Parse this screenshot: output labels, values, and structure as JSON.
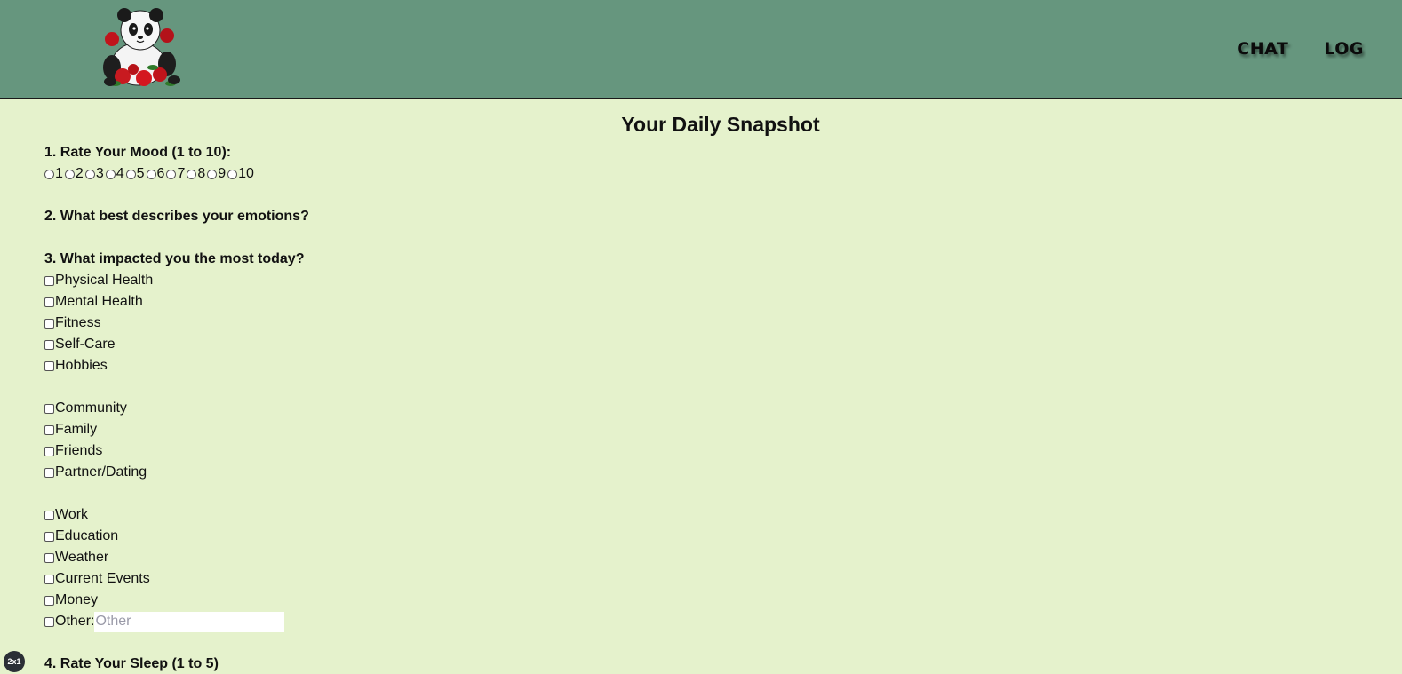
{
  "nav": {
    "chat": "CHAT",
    "log": "LOG"
  },
  "page_title": "Your Daily Snapshot",
  "q1": {
    "label": "1. Rate Your Mood (1 to 10):",
    "options": [
      "1",
      "2",
      "3",
      "4",
      "5",
      "6",
      "7",
      "8",
      "9",
      "10"
    ]
  },
  "q2": {
    "label": "2. What best describes your emotions?"
  },
  "q3": {
    "label": "3. What impacted you the most today?",
    "group1": [
      "Physical Health",
      "Mental Health",
      "Fitness",
      "Self-Care",
      "Hobbies"
    ],
    "group2": [
      "Community",
      "Family",
      "Friends",
      "Partner/Dating"
    ],
    "group3": [
      "Work",
      "Education",
      "Weather",
      "Current Events",
      "Money"
    ],
    "other_label": "Other:",
    "other_placeholder": "Other"
  },
  "q4": {
    "label": "4. Rate Your Sleep (1 to 5)"
  },
  "badge": "2x1",
  "colors": {
    "header": "#66967e",
    "background": "#e5f2cc"
  }
}
